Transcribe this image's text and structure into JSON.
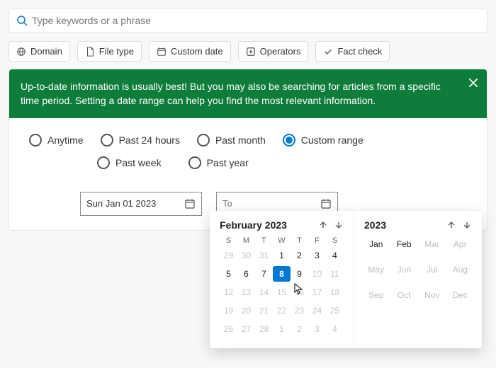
{
  "search": {
    "placeholder": "Type keywords or a phrase"
  },
  "chips": {
    "domain": "Domain",
    "filetype": "File type",
    "customdate": "Custom date",
    "operators": "Operators",
    "factcheck": "Fact check"
  },
  "banner": {
    "text": "Up-to-date information is usually best! But you may also be searching for articles from a specific time period. Setting a date range can help you find the most relevant information."
  },
  "radios": {
    "anytime": "Anytime",
    "past24": "Past 24 hours",
    "pastmonth": "Past month",
    "custom": "Custom range",
    "pastweek": "Past week",
    "pastyear": "Past year"
  },
  "datefields": {
    "from": "Sun Jan 01 2023",
    "to_placeholder": "To"
  },
  "calendar": {
    "title": "February 2023",
    "dow": {
      "s1": "S",
      "m": "M",
      "t1": "T",
      "w": "W",
      "t2": "T",
      "f": "F",
      "s2": "S"
    },
    "cells": [
      {
        "v": "29",
        "cls": "out"
      },
      {
        "v": "30",
        "cls": "out"
      },
      {
        "v": "31",
        "cls": "out"
      },
      {
        "v": "1"
      },
      {
        "v": "2"
      },
      {
        "v": "3"
      },
      {
        "v": "4"
      },
      {
        "v": "5"
      },
      {
        "v": "6"
      },
      {
        "v": "7"
      },
      {
        "v": "8",
        "cls": "today"
      },
      {
        "v": "9"
      },
      {
        "v": "10",
        "cls": "out"
      },
      {
        "v": "11",
        "cls": "out"
      },
      {
        "v": "12",
        "cls": "out"
      },
      {
        "v": "13",
        "cls": "out"
      },
      {
        "v": "14",
        "cls": "out"
      },
      {
        "v": "15",
        "cls": "out"
      },
      {
        "v": "16",
        "cls": "out"
      },
      {
        "v": "17",
        "cls": "out"
      },
      {
        "v": "18",
        "cls": "out"
      },
      {
        "v": "19",
        "cls": "out"
      },
      {
        "v": "20",
        "cls": "out"
      },
      {
        "v": "21",
        "cls": "out"
      },
      {
        "v": "22",
        "cls": "out"
      },
      {
        "v": "23",
        "cls": "out"
      },
      {
        "v": "24",
        "cls": "out"
      },
      {
        "v": "25",
        "cls": "out"
      },
      {
        "v": "26",
        "cls": "out"
      },
      {
        "v": "27",
        "cls": "out"
      },
      {
        "v": "28",
        "cls": "out"
      },
      {
        "v": "1",
        "cls": "out"
      },
      {
        "v": "2",
        "cls": "out"
      },
      {
        "v": "3",
        "cls": "out"
      },
      {
        "v": "4",
        "cls": "out"
      }
    ]
  },
  "yearpanel": {
    "title": "2023",
    "months": [
      {
        "v": "Jan",
        "cls": "active"
      },
      {
        "v": "Feb",
        "cls": "active"
      },
      {
        "v": "Mar"
      },
      {
        "v": "Apr"
      },
      {
        "v": "May"
      },
      {
        "v": "Jun"
      },
      {
        "v": "Jul"
      },
      {
        "v": "Aug"
      },
      {
        "v": "Sep"
      },
      {
        "v": "Oct"
      },
      {
        "v": "Nov"
      },
      {
        "v": "Dec"
      }
    ]
  }
}
